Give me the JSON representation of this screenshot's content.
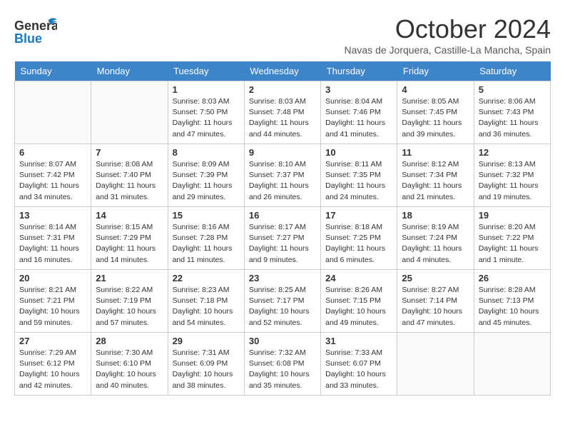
{
  "header": {
    "logo_line1": "General",
    "logo_line2": "Blue",
    "month_title": "October 2024",
    "location": "Navas de Jorquera, Castille-La Mancha, Spain"
  },
  "days_of_week": [
    "Sunday",
    "Monday",
    "Tuesday",
    "Wednesday",
    "Thursday",
    "Friday",
    "Saturday"
  ],
  "weeks": [
    [
      {
        "day": "",
        "info": ""
      },
      {
        "day": "",
        "info": ""
      },
      {
        "day": "1",
        "info": "Sunrise: 8:03 AM\nSunset: 7:50 PM\nDaylight: 11 hours and 47 minutes."
      },
      {
        "day": "2",
        "info": "Sunrise: 8:03 AM\nSunset: 7:48 PM\nDaylight: 11 hours and 44 minutes."
      },
      {
        "day": "3",
        "info": "Sunrise: 8:04 AM\nSunset: 7:46 PM\nDaylight: 11 hours and 41 minutes."
      },
      {
        "day": "4",
        "info": "Sunrise: 8:05 AM\nSunset: 7:45 PM\nDaylight: 11 hours and 39 minutes."
      },
      {
        "day": "5",
        "info": "Sunrise: 8:06 AM\nSunset: 7:43 PM\nDaylight: 11 hours and 36 minutes."
      }
    ],
    [
      {
        "day": "6",
        "info": "Sunrise: 8:07 AM\nSunset: 7:42 PM\nDaylight: 11 hours and 34 minutes."
      },
      {
        "day": "7",
        "info": "Sunrise: 8:08 AM\nSunset: 7:40 PM\nDaylight: 11 hours and 31 minutes."
      },
      {
        "day": "8",
        "info": "Sunrise: 8:09 AM\nSunset: 7:39 PM\nDaylight: 11 hours and 29 minutes."
      },
      {
        "day": "9",
        "info": "Sunrise: 8:10 AM\nSunset: 7:37 PM\nDaylight: 11 hours and 26 minutes."
      },
      {
        "day": "10",
        "info": "Sunrise: 8:11 AM\nSunset: 7:35 PM\nDaylight: 11 hours and 24 minutes."
      },
      {
        "day": "11",
        "info": "Sunrise: 8:12 AM\nSunset: 7:34 PM\nDaylight: 11 hours and 21 minutes."
      },
      {
        "day": "12",
        "info": "Sunrise: 8:13 AM\nSunset: 7:32 PM\nDaylight: 11 hours and 19 minutes."
      }
    ],
    [
      {
        "day": "13",
        "info": "Sunrise: 8:14 AM\nSunset: 7:31 PM\nDaylight: 11 hours and 16 minutes."
      },
      {
        "day": "14",
        "info": "Sunrise: 8:15 AM\nSunset: 7:29 PM\nDaylight: 11 hours and 14 minutes."
      },
      {
        "day": "15",
        "info": "Sunrise: 8:16 AM\nSunset: 7:28 PM\nDaylight: 11 hours and 11 minutes."
      },
      {
        "day": "16",
        "info": "Sunrise: 8:17 AM\nSunset: 7:27 PM\nDaylight: 11 hours and 9 minutes."
      },
      {
        "day": "17",
        "info": "Sunrise: 8:18 AM\nSunset: 7:25 PM\nDaylight: 11 hours and 6 minutes."
      },
      {
        "day": "18",
        "info": "Sunrise: 8:19 AM\nSunset: 7:24 PM\nDaylight: 11 hours and 4 minutes."
      },
      {
        "day": "19",
        "info": "Sunrise: 8:20 AM\nSunset: 7:22 PM\nDaylight: 11 hours and 1 minute."
      }
    ],
    [
      {
        "day": "20",
        "info": "Sunrise: 8:21 AM\nSunset: 7:21 PM\nDaylight: 10 hours and 59 minutes."
      },
      {
        "day": "21",
        "info": "Sunrise: 8:22 AM\nSunset: 7:19 PM\nDaylight: 10 hours and 57 minutes."
      },
      {
        "day": "22",
        "info": "Sunrise: 8:23 AM\nSunset: 7:18 PM\nDaylight: 10 hours and 54 minutes."
      },
      {
        "day": "23",
        "info": "Sunrise: 8:25 AM\nSunset: 7:17 PM\nDaylight: 10 hours and 52 minutes."
      },
      {
        "day": "24",
        "info": "Sunrise: 8:26 AM\nSunset: 7:15 PM\nDaylight: 10 hours and 49 minutes."
      },
      {
        "day": "25",
        "info": "Sunrise: 8:27 AM\nSunset: 7:14 PM\nDaylight: 10 hours and 47 minutes."
      },
      {
        "day": "26",
        "info": "Sunrise: 8:28 AM\nSunset: 7:13 PM\nDaylight: 10 hours and 45 minutes."
      }
    ],
    [
      {
        "day": "27",
        "info": "Sunrise: 7:29 AM\nSunset: 6:12 PM\nDaylight: 10 hours and 42 minutes."
      },
      {
        "day": "28",
        "info": "Sunrise: 7:30 AM\nSunset: 6:10 PM\nDaylight: 10 hours and 40 minutes."
      },
      {
        "day": "29",
        "info": "Sunrise: 7:31 AM\nSunset: 6:09 PM\nDaylight: 10 hours and 38 minutes."
      },
      {
        "day": "30",
        "info": "Sunrise: 7:32 AM\nSunset: 6:08 PM\nDaylight: 10 hours and 35 minutes."
      },
      {
        "day": "31",
        "info": "Sunrise: 7:33 AM\nSunset: 6:07 PM\nDaylight: 10 hours and 33 minutes."
      },
      {
        "day": "",
        "info": ""
      },
      {
        "day": "",
        "info": ""
      }
    ]
  ]
}
